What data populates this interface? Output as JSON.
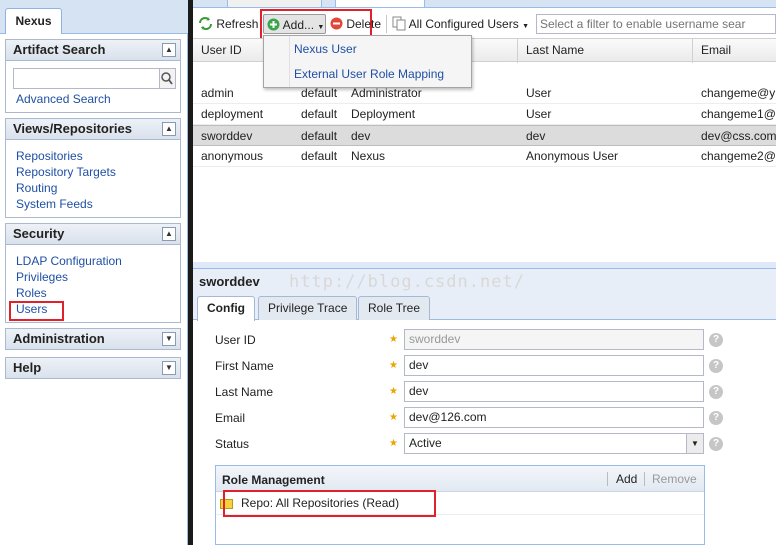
{
  "app": {
    "tab_label": "Nexus"
  },
  "sidebar": {
    "artifact_search": {
      "title": "Artifact Search",
      "search_value": "",
      "advanced_link": "Advanced Search"
    },
    "views": {
      "title": "Views/Repositories",
      "items": [
        "Repositories",
        "Repository Targets",
        "Routing",
        "System Feeds"
      ]
    },
    "security": {
      "title": "Security",
      "items": [
        "LDAP Configuration",
        "Privileges",
        "Roles",
        "Users"
      ]
    },
    "administration": {
      "title": "Administration"
    },
    "help": {
      "title": "Help"
    }
  },
  "toolbar": {
    "refresh": "Refresh",
    "add": "Add...",
    "delete": "Delete",
    "filter_dropdown": "All Configured Users",
    "filter_placeholder": "Select a filter to enable username sear"
  },
  "add_menu": {
    "items": [
      "Nexus User",
      "External User Role Mapping"
    ]
  },
  "grid": {
    "columns": [
      "User ID",
      "",
      "",
      "Last Name",
      "Email"
    ],
    "rows": [
      {
        "user_id": "admin",
        "realm": "default",
        "first_name": "Administrator",
        "last_name": "User",
        "email": "changeme@y"
      },
      {
        "user_id": "deployment",
        "realm": "default",
        "first_name": "Deployment",
        "last_name": "User",
        "email": "changeme1@"
      },
      {
        "user_id": "sworddev",
        "realm": "default",
        "first_name": "dev",
        "last_name": "dev",
        "email": "dev@css.com"
      },
      {
        "user_id": "anonymous",
        "realm": "default",
        "first_name": "Nexus",
        "last_name": "Anonymous User",
        "email": "changeme2@"
      }
    ],
    "selected_index": 2
  },
  "detail": {
    "title": "sworddev",
    "watermark": "http://blog.csdn.net/",
    "tabs": [
      "Config",
      "Privilege Trace",
      "Role Tree"
    ],
    "fields": {
      "user_id": {
        "label": "User ID",
        "value": "sworddev"
      },
      "first_name": {
        "label": "First Name",
        "value": "dev"
      },
      "last_name": {
        "label": "Last Name",
        "value": "dev"
      },
      "email": {
        "label": "Email",
        "value": "dev@126.com"
      },
      "status": {
        "label": "Status",
        "value": "Active"
      }
    },
    "role_management": {
      "title": "Role Management",
      "add": "Add",
      "remove": "Remove",
      "roles": [
        "Repo: All Repositories (Read)"
      ]
    }
  },
  "colors": {
    "highlight_box": "#e0202a",
    "link": "#1f4fa5",
    "panel_border": "#99bbe8"
  }
}
